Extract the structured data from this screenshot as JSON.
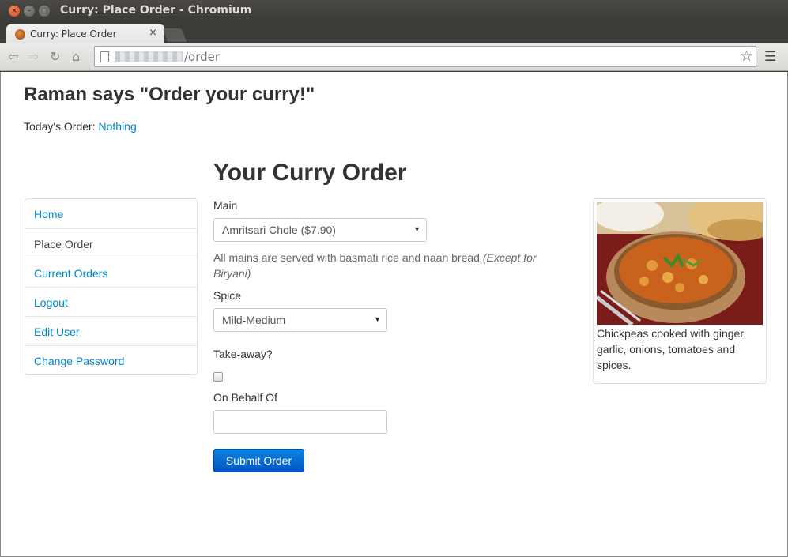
{
  "window": {
    "title": "Curry: Place Order - Chromium"
  },
  "tab": {
    "title": "Curry: Place Order",
    "close": "×"
  },
  "toolbar": {
    "url_path": "/order"
  },
  "page": {
    "site_title": "Raman says \"Order your curry!\"",
    "todays_order_label": "Today's Order:",
    "todays_order_value": "Nothing",
    "heading": "Your Curry Order"
  },
  "sidebar": {
    "items": [
      {
        "label": "Home"
      },
      {
        "label": "Place Order"
      },
      {
        "label": "Current Orders"
      },
      {
        "label": "Logout"
      },
      {
        "label": "Edit User"
      },
      {
        "label": "Change Password"
      }
    ],
    "active": "Place Order"
  },
  "form": {
    "main_label": "Main",
    "main_selected": "Amritsari Chole ($7.90)",
    "help_text": "All mains are served with basmati rice and naan bread",
    "help_italic": "(Except for Biryani)",
    "spice_label": "Spice",
    "spice_selected": "Mild-Medium",
    "takeaway_label": "Take-away?",
    "takeaway_checked": false,
    "behalf_label": "On Behalf Of",
    "behalf_value": "",
    "submit_label": "Submit Order"
  },
  "thumbnail": {
    "caption": "Chickpeas cooked with ginger, garlic, onions, tomatoes and spices."
  },
  "colors": {
    "link": "#0088cc",
    "primary_button": "#0456c4",
    "chrome_dark": "#3c3b37"
  }
}
